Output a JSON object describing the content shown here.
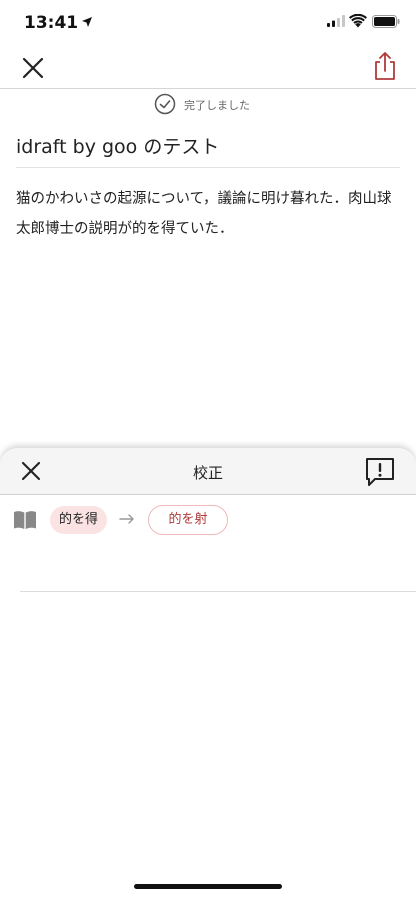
{
  "status_bar": {
    "time": "13:41"
  },
  "save_status": {
    "text": "完了しました"
  },
  "document": {
    "title": "idraft by goo のテスト",
    "body": "猫のかわいさの起源について，議論に明け暮れた．肉山球太郎博士の説明が的を得ていた．"
  },
  "proofread": {
    "title": "校正",
    "suggestion": {
      "original": "的を得",
      "correction": "的を射"
    }
  },
  "colors": {
    "accent": "#b03a3a",
    "chip_bg": "#fbe3e3",
    "chip_border": "#efb9b9"
  }
}
